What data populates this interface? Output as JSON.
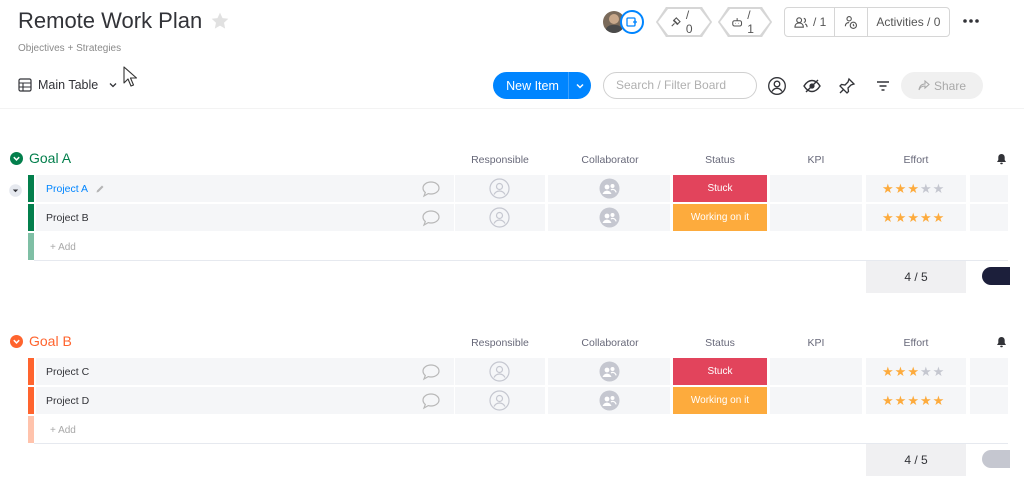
{
  "board": {
    "title": "Remote Work Plan",
    "subtitle": "Objectives + Strategies"
  },
  "header": {
    "integrations_count": "/ 0",
    "automations_count": "/ 1",
    "members_count": "/ 1",
    "activities_label": "Activities / 0"
  },
  "toolbar": {
    "view_label": "Main Table",
    "new_item_label": "New Item",
    "search_placeholder": "Search / Filter Board",
    "share_label": "Share"
  },
  "columns": {
    "responsible": "Responsible",
    "collaborator": "Collaborator",
    "status": "Status",
    "kpi": "KPI",
    "effort": "Effort"
  },
  "colors": {
    "accent": "#0085ff",
    "goal_a": "#037f4c",
    "goal_b": "#ff642e",
    "stuck": "#e2445c",
    "working": "#fdab3d",
    "star_on": "#fdab3d",
    "star_off": "#c5c7d0"
  },
  "groups": [
    {
      "name": "Goal A",
      "add_label": "+ Add",
      "summary": "4 / 5",
      "items": [
        {
          "name": "Project A",
          "status": "Stuck",
          "effort": 3
        },
        {
          "name": "Project B",
          "status": "Working on it",
          "effort": 5
        }
      ]
    },
    {
      "name": "Goal B",
      "add_label": "+ Add",
      "summary": "4 / 5",
      "items": [
        {
          "name": "Project C",
          "status": "Stuck",
          "effort": 3
        },
        {
          "name": "Project D",
          "status": "Working on it",
          "effort": 5
        }
      ]
    }
  ],
  "icons": [
    "star-icon",
    "integrations-icon",
    "automations-icon",
    "members-icon",
    "activity-icon",
    "more-icon",
    "table-icon",
    "chevron-down-icon",
    "person-icon",
    "eye-icon",
    "pin-icon",
    "filter-icon",
    "share-icon",
    "comment-icon",
    "pencil-icon",
    "bell-icon"
  ]
}
